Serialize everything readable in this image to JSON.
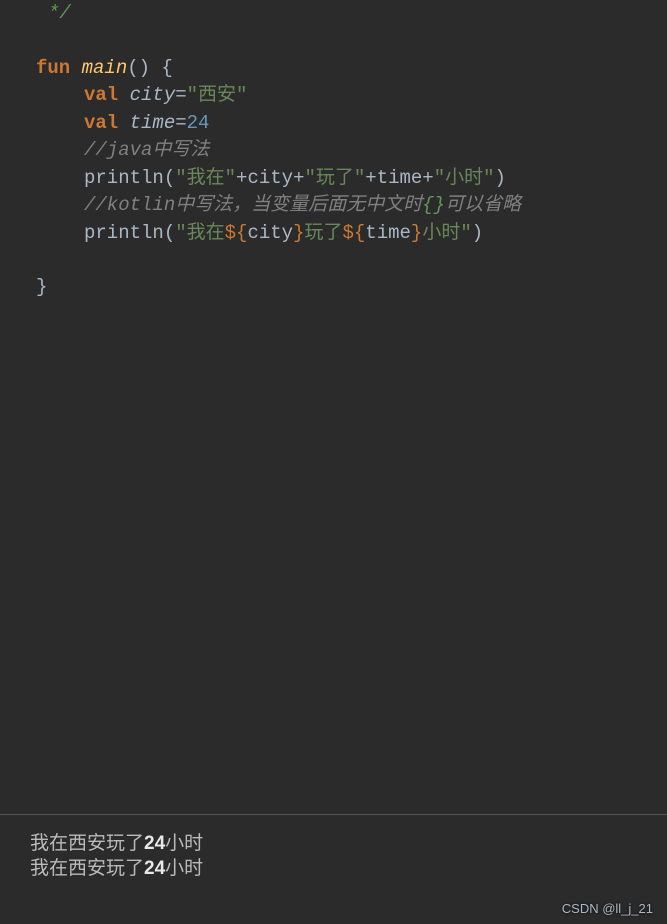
{
  "code": {
    "comment_close": "*/",
    "blank1": "",
    "fun_keyword": "fun ",
    "main_name": "main",
    "main_parens": "()",
    "space_brace": " {",
    "val_keyword": "val ",
    "city_var": "city",
    "eq": "=",
    "city_str": "\"西安\"",
    "time_var": "time",
    "time_val": "24",
    "comment_java": "//java中写法",
    "println": "println",
    "open_paren": "(",
    "close_paren": ")",
    "str1": "\"我在\"",
    "plus": "+",
    "city_ref": "city",
    "str2": "\"玩了\"",
    "time_ref": "time",
    "str3": "\"小时\"",
    "comment_kotlin_1": "//kotlin中写法，当变量后面无中文时",
    "comment_kotlin_braces": "{}",
    "comment_kotlin_2": "可以省略",
    "str_k1": "\"我在",
    "tmpl_open": "${",
    "tmpl_city": "city",
    "tmpl_close": "}",
    "str_k2": "玩了",
    "tmpl_time": "time",
    "str_k3": "小时\"",
    "close_brace": "}"
  },
  "output": {
    "line1_a": "我在西安玩了",
    "line1_b": "24",
    "line1_c": "小时",
    "line2_a": "我在西安玩了",
    "line2_b": "24",
    "line2_c": "小时"
  },
  "watermark": "CSDN @ll_j_21"
}
